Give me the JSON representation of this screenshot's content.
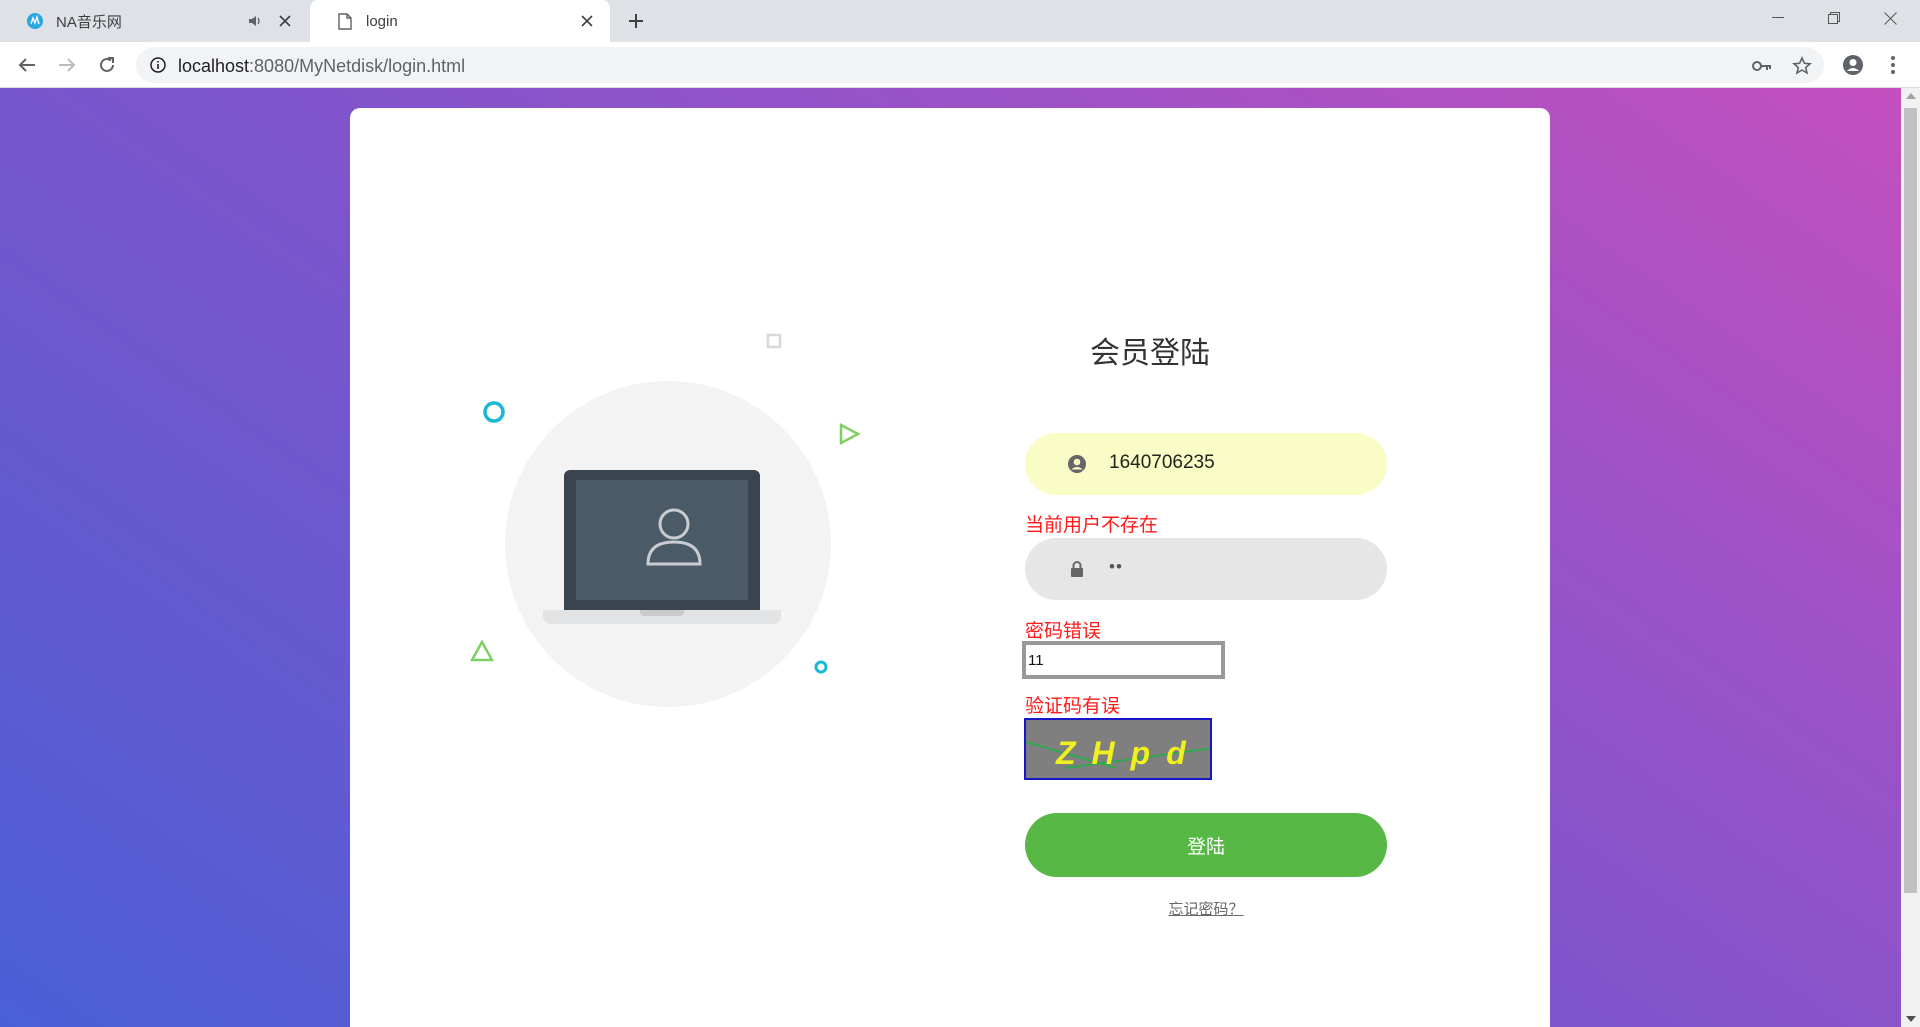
{
  "browser": {
    "tabs": [
      {
        "title": "NA音乐网",
        "active": false
      },
      {
        "title": "login",
        "active": true
      }
    ],
    "url_host": "localhost",
    "url_rest": ":8080/MyNetdisk/login.html"
  },
  "login": {
    "title": "会员登陆",
    "username_value": "1640706235",
    "username_error": "当前用户不存在",
    "password_value": "••",
    "password_error": "密码错误",
    "captcha_value": "11",
    "captcha_error": "验证码有误",
    "captcha_text": "ZHpd",
    "submit_label": "登陆",
    "forgot_label": "忘记密码？"
  },
  "colors": {
    "accent_green": "#57b846",
    "error_red": "#ff1a1a",
    "username_bg": "#fafcc6"
  }
}
